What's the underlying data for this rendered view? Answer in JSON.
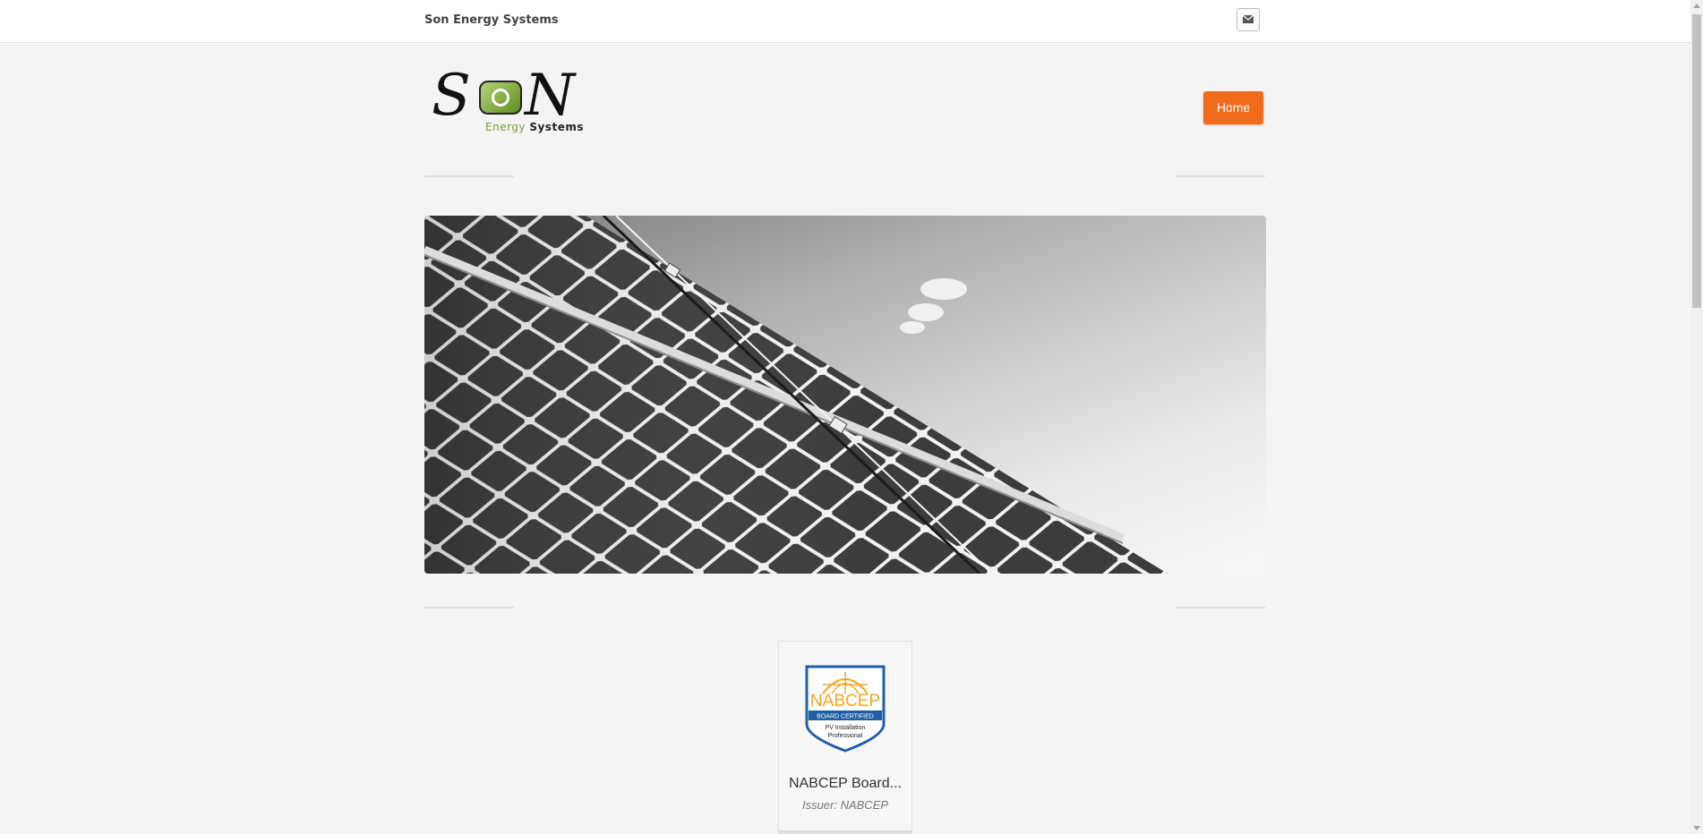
{
  "header": {
    "site_name": "Son Energy Systems",
    "contact_icon": "mail-icon"
  },
  "logo": {
    "letters_left": "S",
    "letters_right": "N",
    "tagline_green": "Energy",
    "tagline_dark": "Systems"
  },
  "nav": {
    "items": [
      {
        "label": "Home",
        "active": true
      }
    ]
  },
  "hero": {
    "image": "solar-panels-photo"
  },
  "certifications": [
    {
      "title": "NABCEP Board...",
      "issuer": "Issuer: NABCEP",
      "badge": {
        "name": "NABCEP",
        "band": "BOARD CERTIFIED",
        "line1": "PV Installation",
        "line2": "Professional"
      }
    }
  ],
  "colors": {
    "accent": "#f26b1d",
    "logo_green": "#7aa12f",
    "badge_orange": "#f5a623",
    "badge_blue": "#1f5fa8"
  }
}
